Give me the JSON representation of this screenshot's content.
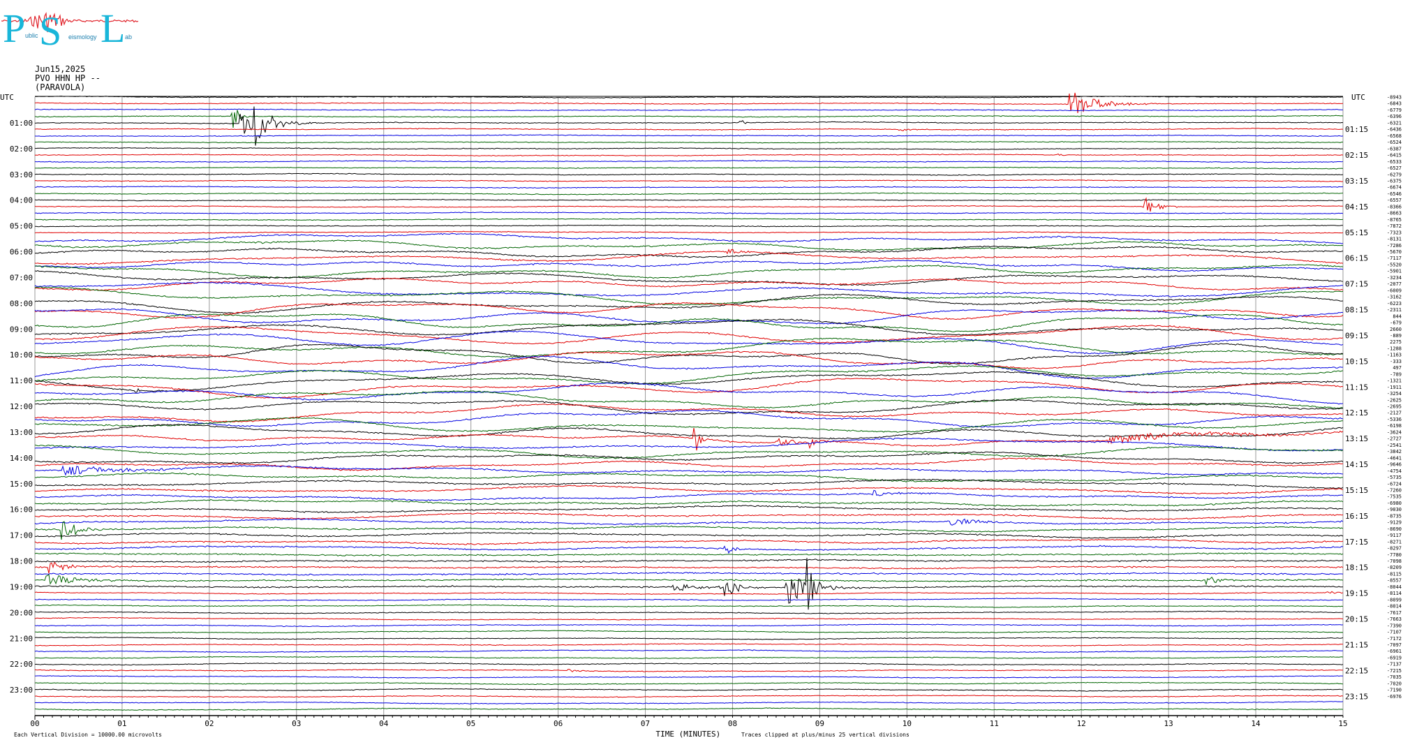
{
  "logo": {
    "letters": [
      "P",
      "S",
      "L"
    ],
    "small_words": [
      "ublic",
      "eismology",
      "ab"
    ],
    "color": "#19b6d9",
    "wave_color": "#e0222a"
  },
  "header": {
    "date": "Jun15,2025",
    "station": "PVO HHN HP --",
    "location": "(PARAVOLA)"
  },
  "chart_data": {
    "type": "line",
    "title": "",
    "left_axis_header": "UTC",
    "right_axis_header": "UTC",
    "left_hour_labels": [
      "01:00",
      "02:00",
      "03:00",
      "04:00",
      "05:00",
      "06:00",
      "07:00",
      "08:00",
      "09:00",
      "10:00",
      "11:00",
      "12:00",
      "13:00",
      "14:00",
      "15:00",
      "16:00",
      "17:00",
      "18:00",
      "19:00",
      "20:00",
      "21:00",
      "22:00",
      "23:00"
    ],
    "right_hour_labels": [
      "01:15",
      "02:15",
      "03:15",
      "04:15",
      "05:15",
      "06:15",
      "07:15",
      "08:15",
      "09:15",
      "10:15",
      "11:15",
      "12:15",
      "13:15",
      "14:15",
      "15:15",
      "16:15",
      "17:15",
      "18:15",
      "19:15",
      "20:15",
      "21:15",
      "22:15",
      "23:15"
    ],
    "x_tick_labels": [
      "00",
      "01",
      "02",
      "03",
      "04",
      "05",
      "06",
      "07",
      "08",
      "09",
      "10",
      "11",
      "12",
      "13",
      "14",
      "15"
    ],
    "xlim": [
      0,
      15
    ],
    "xlabel": "TIME (MINUTES)",
    "trace_count": 96,
    "trace_colors": [
      "#000000",
      "#e00000",
      "#0000e0",
      "#006400"
    ],
    "trace_offsets": [
      -8943,
      -6843,
      -6779,
      -6396,
      -6321,
      -6436,
      -6568,
      -6524,
      -6387,
      -6415,
      -6533,
      -6527,
      -6279,
      -6375,
      -6674,
      -6546,
      -6557,
      -8366,
      -8663,
      -8765,
      -7872,
      -7323,
      -8131,
      -7286,
      -5670,
      -7117,
      -5520,
      -5901,
      -3234,
      -2077,
      -6009,
      -3162,
      -6223,
      -2311,
      844,
      -679,
      2660,
      -889,
      2275,
      -1288,
      -1163,
      -333,
      497,
      -789,
      -1321,
      -1911,
      -3254,
      -2625,
      -2695,
      -2127,
      -5336,
      -6198,
      -3624,
      -2727,
      -2541,
      -3842,
      -4641,
      -9646,
      -4754,
      -5735,
      -6724,
      -7260,
      -7535,
      -6980,
      -9030,
      -8735,
      -9129,
      -8690,
      -9117,
      -8271,
      -8297,
      -7780,
      -7098,
      -8209,
      -8115,
      -8557,
      -8044,
      -8114,
      -8099,
      -8014,
      -7617,
      -7663,
      -7390,
      -7107,
      -7172,
      -7097,
      -6961,
      -6919,
      -7137,
      -7215,
      -7035,
      -7020,
      -7190,
      -6976
    ],
    "scale_note": "Each Vertical Division = 10000.00 microvolts",
    "clip_note": "Traces clipped at plus/minus 25 vertical divisions",
    "events": [
      {
        "trace": 3,
        "minute": 2.25,
        "amp": 24,
        "dur": 0.15
      },
      {
        "trace": 4,
        "minute": 2.35,
        "amp": 30,
        "dur": 0.15
      },
      {
        "trace": 4,
        "minute": 2.47,
        "amp": 50,
        "dur": 0.35
      },
      {
        "trace": 4,
        "minute": 8.08,
        "amp": 6,
        "dur": 0.1
      },
      {
        "trace": 1,
        "minute": 11.85,
        "amp": 22,
        "dur": 0.55
      },
      {
        "trace": 5,
        "minute": 9.9,
        "amp": 3,
        "dur": 0.25
      },
      {
        "trace": 17,
        "minute": 12.7,
        "amp": 18,
        "dur": 0.25
      },
      {
        "trace": 9,
        "minute": 11.7,
        "amp": 3,
        "dur": 0.15
      },
      {
        "trace": 23,
        "minute": 2.6,
        "amp": 3,
        "dur": 0.2
      },
      {
        "trace": 25,
        "minute": 7.9,
        "amp": 5,
        "dur": 0.4
      },
      {
        "trace": 44,
        "minute": 1.15,
        "amp": 10,
        "dur": 0.05
      },
      {
        "trace": 53,
        "minute": 7.55,
        "amp": 70,
        "dur": 0.08
      },
      {
        "trace": 53,
        "minute": 8.5,
        "amp": 7,
        "dur": 0.5
      },
      {
        "trace": 53,
        "minute": 8.88,
        "amp": 11,
        "dur": 0.15
      },
      {
        "trace": 53,
        "minute": 12.3,
        "amp": 6,
        "dur": 2.7
      },
      {
        "trace": 58,
        "minute": 0.3,
        "amp": 8,
        "dur": 1.2
      },
      {
        "trace": 62,
        "minute": 9.6,
        "amp": 6,
        "dur": 0.4
      },
      {
        "trace": 66,
        "minute": 10.5,
        "amp": 6,
        "dur": 0.6
      },
      {
        "trace": 67,
        "minute": 0.3,
        "amp": 18,
        "dur": 0.35
      },
      {
        "trace": 70,
        "minute": 7.9,
        "amp": 12,
        "dur": 0.2
      },
      {
        "trace": 73,
        "minute": 0.15,
        "amp": 9,
        "dur": 0.4
      },
      {
        "trace": 75,
        "minute": 0.1,
        "amp": 11,
        "dur": 0.6
      },
      {
        "trace": 75,
        "minute": 13.4,
        "amp": 8,
        "dur": 0.35
      },
      {
        "trace": 76,
        "minute": 7.3,
        "amp": 7,
        "dur": 0.6
      },
      {
        "trace": 76,
        "minute": 7.9,
        "amp": 28,
        "dur": 0.2
      },
      {
        "trace": 76,
        "minute": 8.6,
        "amp": 35,
        "dur": 0.4
      },
      {
        "trace": 76,
        "minute": 8.85,
        "amp": 50,
        "dur": 0.15
      },
      {
        "trace": 77,
        "minute": 14.8,
        "amp": 4,
        "dur": 0.2
      },
      {
        "trace": 89,
        "minute": 6.1,
        "amp": 3,
        "dur": 0.2
      }
    ]
  }
}
